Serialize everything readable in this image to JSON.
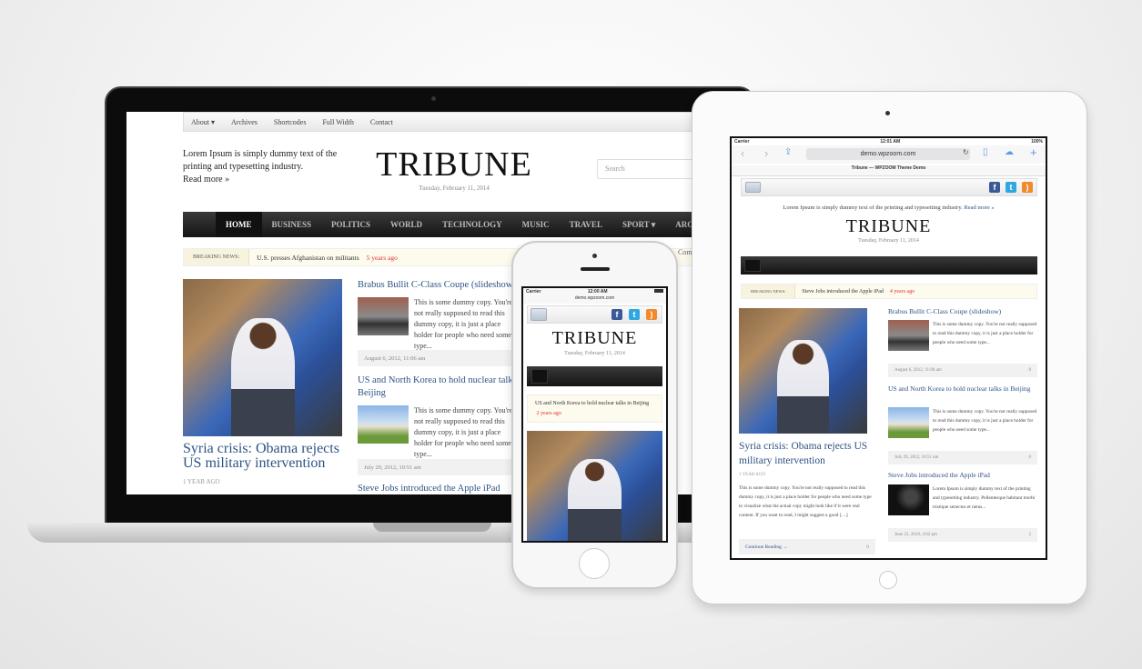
{
  "site": {
    "logo": "TRIBUNE",
    "date": "Tuesday, February 11, 2014",
    "blurb": "Lorem Ipsum is simply dummy text of the printing and typesetting industry.",
    "read_more": "Read more »"
  },
  "laptop": {
    "topnav": [
      "About ▾",
      "Archives",
      "Shortcodes",
      "Full Width",
      "Contact"
    ],
    "search_placeholder": "Search",
    "mainnav": [
      "HOME",
      "BUSINESS",
      "POLITICS",
      "WORLD",
      "TECHNOLOGY",
      "MUSIC",
      "TRAVEL",
      "SPORT ▾",
      "ARCHIVES"
    ],
    "breaking_label": "BREAKING NEWS:",
    "breaking_text": "U.S. presses Afghanistan on militants",
    "breaking_age": "5 years ago",
    "side_fragment": "Com",
    "featured": {
      "title": "Syria crisis: Obama rejects US military intervention",
      "age": "1 YEAR AGO"
    },
    "posts": [
      {
        "title": "Brabus Bullit C-Class Coupe (slideshow)",
        "excerpt": "This is some dummy copy. You're not really supposed to read this dummy copy, it is just a place holder for people who need some type...",
        "date": "August 6, 2012, 11:06 am"
      },
      {
        "title": "US and North Korea to hold nuclear talks in Beijing",
        "excerpt": "This is some dummy copy. You're not really supposed to read this dummy copy, it is just a place holder for people who need some type...",
        "date": "July 29, 2012, 10:51 am"
      },
      {
        "title": "Steve Jobs introduced the Apple iPad"
      }
    ]
  },
  "ipad": {
    "status": {
      "carrier": "Carrier",
      "time": "12:01 AM",
      "battery": "100%"
    },
    "url": "demo.wpzoom.com",
    "page_title": "Tribune — WPZOOM Theme Demo",
    "breaking_label": "BREAKING NEWS:",
    "breaking_text": "Steve Jobs introduced the Apple iPad",
    "breaking_age": "4 years ago",
    "featured": {
      "title": "Syria crisis: Obama rejects US military intervention",
      "age": "1 YEAR AGO",
      "excerpt": "This is some dummy copy. You're not really supposed to read this dummy copy, it is just a place holder for people who need some type to visualize what the actual copy might look like if it were real content. If you want to read, I might suggest a good […]",
      "continue": "Continue Reading →",
      "comments": "0"
    },
    "posts": [
      {
        "title": "Brabus Bullit C-Class Coupe (slideshow)",
        "excerpt": "This is some dummy copy. You're not really supposed to read this dummy copy, it is just a place holder for people who need some type...",
        "date": "August 6, 2012, 11:06 am",
        "comments": "0"
      },
      {
        "title": "US and North Korea to hold nuclear talks in Beijing",
        "excerpt": "This is some dummy copy. You're not really supposed to read this dummy copy, it is just a place holder for people who need some type...",
        "date": "July 29, 2012, 10:51 am",
        "comments": "0"
      },
      {
        "title": "Steve Jobs introduced the Apple iPad",
        "excerpt": "Lorem Ipsum is simply dummy text of the printing and typesetting industry. Pellentesque habitant morbi tristique senectus et netus...",
        "date": "June 23, 2010, 4:02 pm",
        "comments": "2"
      }
    ]
  },
  "iphone": {
    "status": {
      "carrier": "Carrier",
      "time": "12:00 AM"
    },
    "url": "demo.wpzoom.com",
    "breaking_text": "US and North Korea to hold nuclear talks in Beijing",
    "breaking_age": "2 years ago"
  },
  "colors": {
    "link": "#2e5384",
    "breaking_age": "#dd3333",
    "nav_dark": "#1a1a1a",
    "facebook": "#3b5998",
    "twitter": "#2fa7e0",
    "rss": "#f08a2c"
  }
}
